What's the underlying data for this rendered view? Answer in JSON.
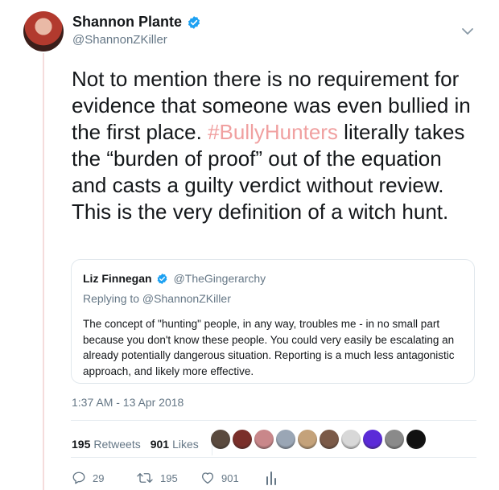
{
  "tweet": {
    "author": {
      "name": "Shannon Plante",
      "handle": "@ShannonZKiller"
    },
    "text_before_hashtag": "Not to mention there is no requirement for evidence that someone was even bullied in the first place. ",
    "hashtag": "#BullyHunters",
    "text_after_hashtag": " literally takes the “burden of proof” out of the equation and casts a guilty verdict without review. This is the very definition of a witch hunt.",
    "timestamp": "1:37 AM - 13 Apr 2018"
  },
  "quote": {
    "name": "Liz Finnegan",
    "handle": "@TheGingerarchy",
    "replying_to": "Replying to @ShannonZKiller",
    "text": "The concept of \"hunting\" people, in any way, troubles me - in no small part because you don't know these people. You could very easily be escalating an already potentially dangerous situation. Reporting is a much less antagonistic approach, and likely more effective."
  },
  "stats": {
    "retweets_count": "195",
    "retweets_label": "Retweets",
    "likes_count": "901",
    "likes_label": "Likes"
  },
  "likers": [
    {
      "name": "liker-avatar-1",
      "color": "#5a4a3e"
    },
    {
      "name": "liker-avatar-2",
      "color": "#7a2f2a"
    },
    {
      "name": "liker-avatar-3",
      "color": "#c9878a"
    },
    {
      "name": "liker-avatar-4",
      "color": "#9aa6b5"
    },
    {
      "name": "liker-avatar-5",
      "color": "#c4a27a"
    },
    {
      "name": "liker-avatar-6",
      "color": "#7b5a48"
    },
    {
      "name": "liker-avatar-7",
      "color": "#d8d8d8"
    },
    {
      "name": "liker-avatar-8",
      "color": "#5b2bd8"
    },
    {
      "name": "liker-avatar-9",
      "color": "#8a8a8a"
    },
    {
      "name": "liker-avatar-10",
      "color": "#111111"
    }
  ],
  "actions": {
    "replies": "29",
    "retweets": "195",
    "likes": "901"
  },
  "colors": {
    "verified": "#1da1f2",
    "hashtag": "#f0a0a0",
    "muted": "#657786"
  }
}
